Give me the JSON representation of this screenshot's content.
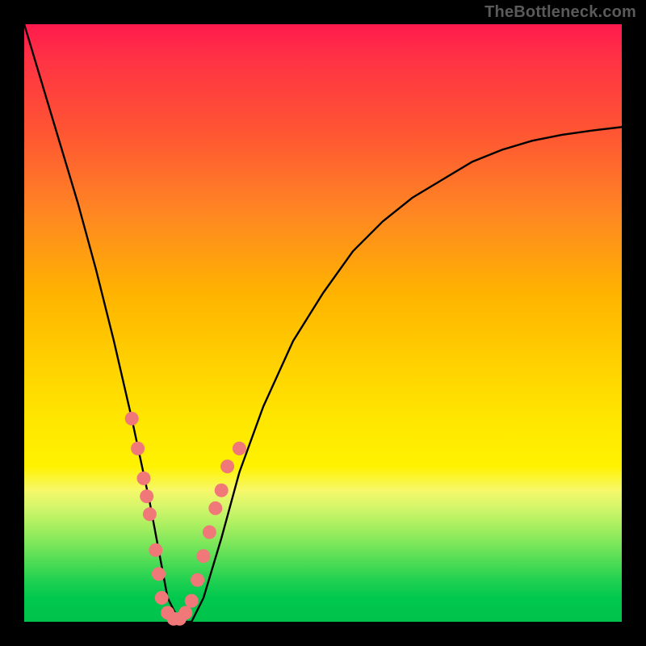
{
  "watermark": "TheBottleneck.com",
  "chart_data": {
    "type": "line",
    "title": "",
    "xlabel": "",
    "ylabel": "",
    "xlim": [
      0,
      100
    ],
    "ylim": [
      0,
      100
    ],
    "x": [
      0,
      3,
      6,
      9,
      12,
      15,
      18,
      21,
      22.5,
      24,
      26,
      28,
      30,
      33,
      36,
      40,
      45,
      50,
      55,
      60,
      65,
      70,
      75,
      80,
      85,
      90,
      95,
      100
    ],
    "values": [
      100,
      90,
      80,
      70,
      59,
      47,
      34,
      20,
      12,
      4,
      0,
      0,
      4,
      14,
      25,
      36,
      47,
      55,
      62,
      67,
      71,
      74,
      77,
      79,
      80.5,
      81.5,
      82.2,
      82.8
    ],
    "markers": {
      "x": [
        18,
        19,
        20,
        20.5,
        21,
        22,
        22.5,
        23,
        24,
        25,
        26,
        27,
        28,
        29,
        30,
        31,
        32,
        33,
        34,
        36
      ],
      "values": [
        34,
        29,
        24,
        21,
        18,
        12,
        8,
        4,
        1.5,
        0.5,
        0.5,
        1.5,
        3.5,
        7,
        11,
        15,
        19,
        22,
        26,
        29
      ]
    },
    "colors": {
      "curve": "#000000",
      "marker_fill": "#f07878",
      "marker_stroke": "#a04040",
      "gradient_top": "#ff1a4d",
      "gradient_bottom": "#00c24c"
    }
  }
}
